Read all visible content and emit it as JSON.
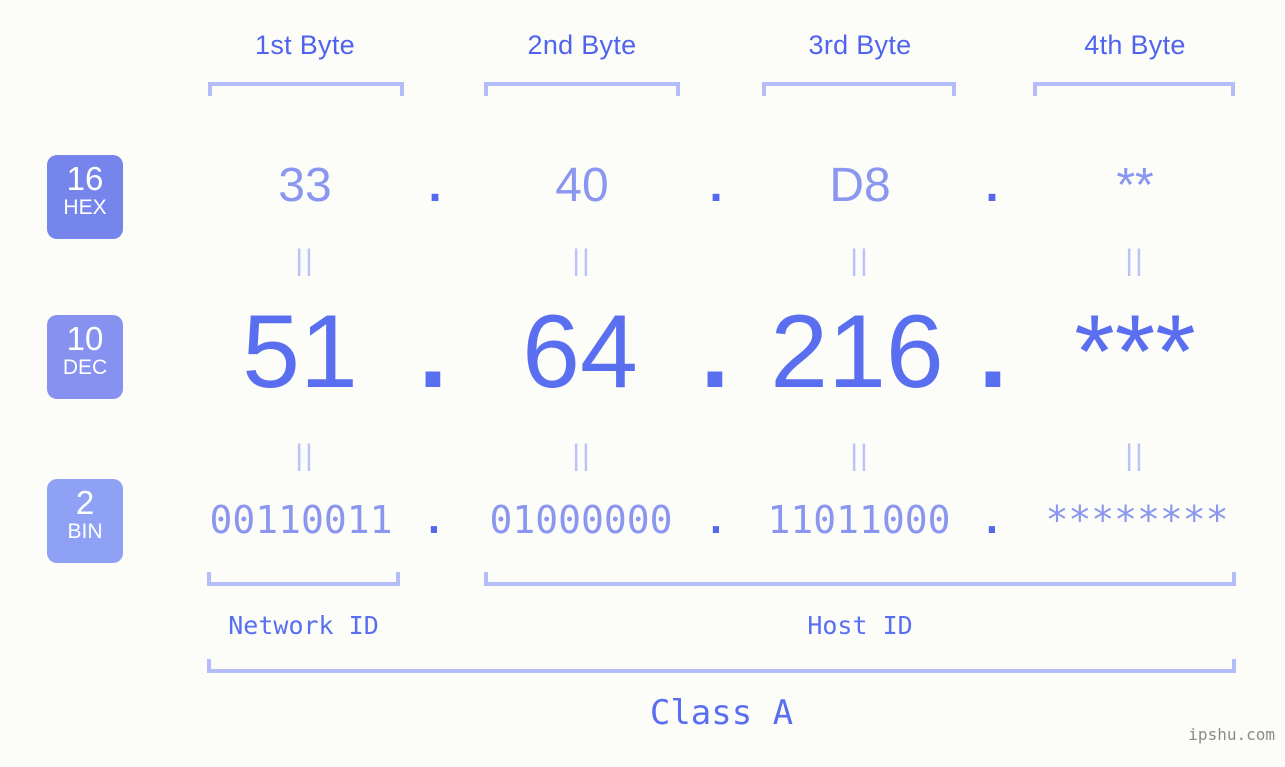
{
  "background_color": "#fcfdf8",
  "accent_colors": {
    "primary_blue": "#5a6ff0",
    "light_blue": "#8a96ef",
    "bracket_blue": "#b4bdfa",
    "equals_blue": "#b9c2fb",
    "badge_hex": "#7585ec",
    "badge_dec": "#8792f0",
    "badge_bin": "#8ea1f5",
    "watermark_gray": "#8a8a8a"
  },
  "byte_headers": [
    {
      "label": "1st Byte"
    },
    {
      "label": "2nd Byte"
    },
    {
      "label": "3rd Byte"
    },
    {
      "label": "4th Byte"
    }
  ],
  "bases": [
    {
      "number": "16",
      "abbr": "HEX"
    },
    {
      "number": "10",
      "abbr": "DEC"
    },
    {
      "number": "2",
      "abbr": "BIN"
    }
  ],
  "rows": {
    "hex": {
      "values": [
        "33",
        "40",
        "D8",
        "**"
      ],
      "separator": "."
    },
    "dec": {
      "values": [
        "51",
        "64",
        "216",
        "***"
      ],
      "separator": "."
    },
    "bin": {
      "values": [
        "00110011",
        "01000000",
        "11011000",
        "********"
      ],
      "separator": "."
    }
  },
  "equals_marker": "||",
  "segments": {
    "network_id": "Network ID",
    "host_id": "Host ID",
    "class": "Class A"
  },
  "watermark": "ipshu.com"
}
